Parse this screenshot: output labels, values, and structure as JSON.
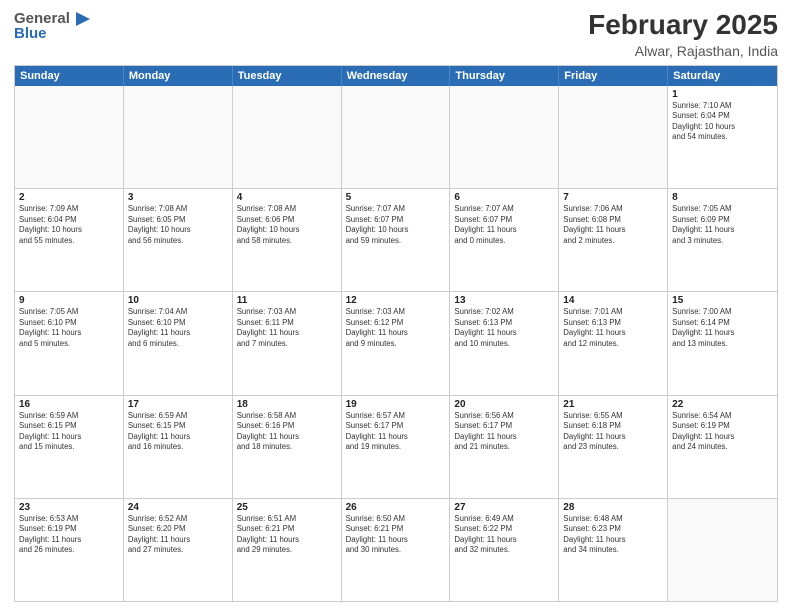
{
  "header": {
    "logo_general": "General",
    "logo_blue": "Blue",
    "month": "February 2025",
    "location": "Alwar, Rajasthan, India"
  },
  "days_of_week": [
    "Sunday",
    "Monday",
    "Tuesday",
    "Wednesday",
    "Thursday",
    "Friday",
    "Saturday"
  ],
  "weeks": [
    [
      {
        "day": "",
        "info": ""
      },
      {
        "day": "",
        "info": ""
      },
      {
        "day": "",
        "info": ""
      },
      {
        "day": "",
        "info": ""
      },
      {
        "day": "",
        "info": ""
      },
      {
        "day": "",
        "info": ""
      },
      {
        "day": "1",
        "info": "Sunrise: 7:10 AM\nSunset: 6:04 PM\nDaylight: 10 hours\nand 54 minutes."
      }
    ],
    [
      {
        "day": "2",
        "info": "Sunrise: 7:09 AM\nSunset: 6:04 PM\nDaylight: 10 hours\nand 55 minutes."
      },
      {
        "day": "3",
        "info": "Sunrise: 7:08 AM\nSunset: 6:05 PM\nDaylight: 10 hours\nand 56 minutes."
      },
      {
        "day": "4",
        "info": "Sunrise: 7:08 AM\nSunset: 6:06 PM\nDaylight: 10 hours\nand 58 minutes."
      },
      {
        "day": "5",
        "info": "Sunrise: 7:07 AM\nSunset: 6:07 PM\nDaylight: 10 hours\nand 59 minutes."
      },
      {
        "day": "6",
        "info": "Sunrise: 7:07 AM\nSunset: 6:07 PM\nDaylight: 11 hours\nand 0 minutes."
      },
      {
        "day": "7",
        "info": "Sunrise: 7:06 AM\nSunset: 6:08 PM\nDaylight: 11 hours\nand 2 minutes."
      },
      {
        "day": "8",
        "info": "Sunrise: 7:05 AM\nSunset: 6:09 PM\nDaylight: 11 hours\nand 3 minutes."
      }
    ],
    [
      {
        "day": "9",
        "info": "Sunrise: 7:05 AM\nSunset: 6:10 PM\nDaylight: 11 hours\nand 5 minutes."
      },
      {
        "day": "10",
        "info": "Sunrise: 7:04 AM\nSunset: 6:10 PM\nDaylight: 11 hours\nand 6 minutes."
      },
      {
        "day": "11",
        "info": "Sunrise: 7:03 AM\nSunset: 6:11 PM\nDaylight: 11 hours\nand 7 minutes."
      },
      {
        "day": "12",
        "info": "Sunrise: 7:03 AM\nSunset: 6:12 PM\nDaylight: 11 hours\nand 9 minutes."
      },
      {
        "day": "13",
        "info": "Sunrise: 7:02 AM\nSunset: 6:13 PM\nDaylight: 11 hours\nand 10 minutes."
      },
      {
        "day": "14",
        "info": "Sunrise: 7:01 AM\nSunset: 6:13 PM\nDaylight: 11 hours\nand 12 minutes."
      },
      {
        "day": "15",
        "info": "Sunrise: 7:00 AM\nSunset: 6:14 PM\nDaylight: 11 hours\nand 13 minutes."
      }
    ],
    [
      {
        "day": "16",
        "info": "Sunrise: 6:59 AM\nSunset: 6:15 PM\nDaylight: 11 hours\nand 15 minutes."
      },
      {
        "day": "17",
        "info": "Sunrise: 6:59 AM\nSunset: 6:15 PM\nDaylight: 11 hours\nand 16 minutes."
      },
      {
        "day": "18",
        "info": "Sunrise: 6:58 AM\nSunset: 6:16 PM\nDaylight: 11 hours\nand 18 minutes."
      },
      {
        "day": "19",
        "info": "Sunrise: 6:57 AM\nSunset: 6:17 PM\nDaylight: 11 hours\nand 19 minutes."
      },
      {
        "day": "20",
        "info": "Sunrise: 6:56 AM\nSunset: 6:17 PM\nDaylight: 11 hours\nand 21 minutes."
      },
      {
        "day": "21",
        "info": "Sunrise: 6:55 AM\nSunset: 6:18 PM\nDaylight: 11 hours\nand 23 minutes."
      },
      {
        "day": "22",
        "info": "Sunrise: 6:54 AM\nSunset: 6:19 PM\nDaylight: 11 hours\nand 24 minutes."
      }
    ],
    [
      {
        "day": "23",
        "info": "Sunrise: 6:53 AM\nSunset: 6:19 PM\nDaylight: 11 hours\nand 26 minutes."
      },
      {
        "day": "24",
        "info": "Sunrise: 6:52 AM\nSunset: 6:20 PM\nDaylight: 11 hours\nand 27 minutes."
      },
      {
        "day": "25",
        "info": "Sunrise: 6:51 AM\nSunset: 6:21 PM\nDaylight: 11 hours\nand 29 minutes."
      },
      {
        "day": "26",
        "info": "Sunrise: 6:50 AM\nSunset: 6:21 PM\nDaylight: 11 hours\nand 30 minutes."
      },
      {
        "day": "27",
        "info": "Sunrise: 6:49 AM\nSunset: 6:22 PM\nDaylight: 11 hours\nand 32 minutes."
      },
      {
        "day": "28",
        "info": "Sunrise: 6:48 AM\nSunset: 6:23 PM\nDaylight: 11 hours\nand 34 minutes."
      },
      {
        "day": "",
        "info": ""
      }
    ]
  ]
}
